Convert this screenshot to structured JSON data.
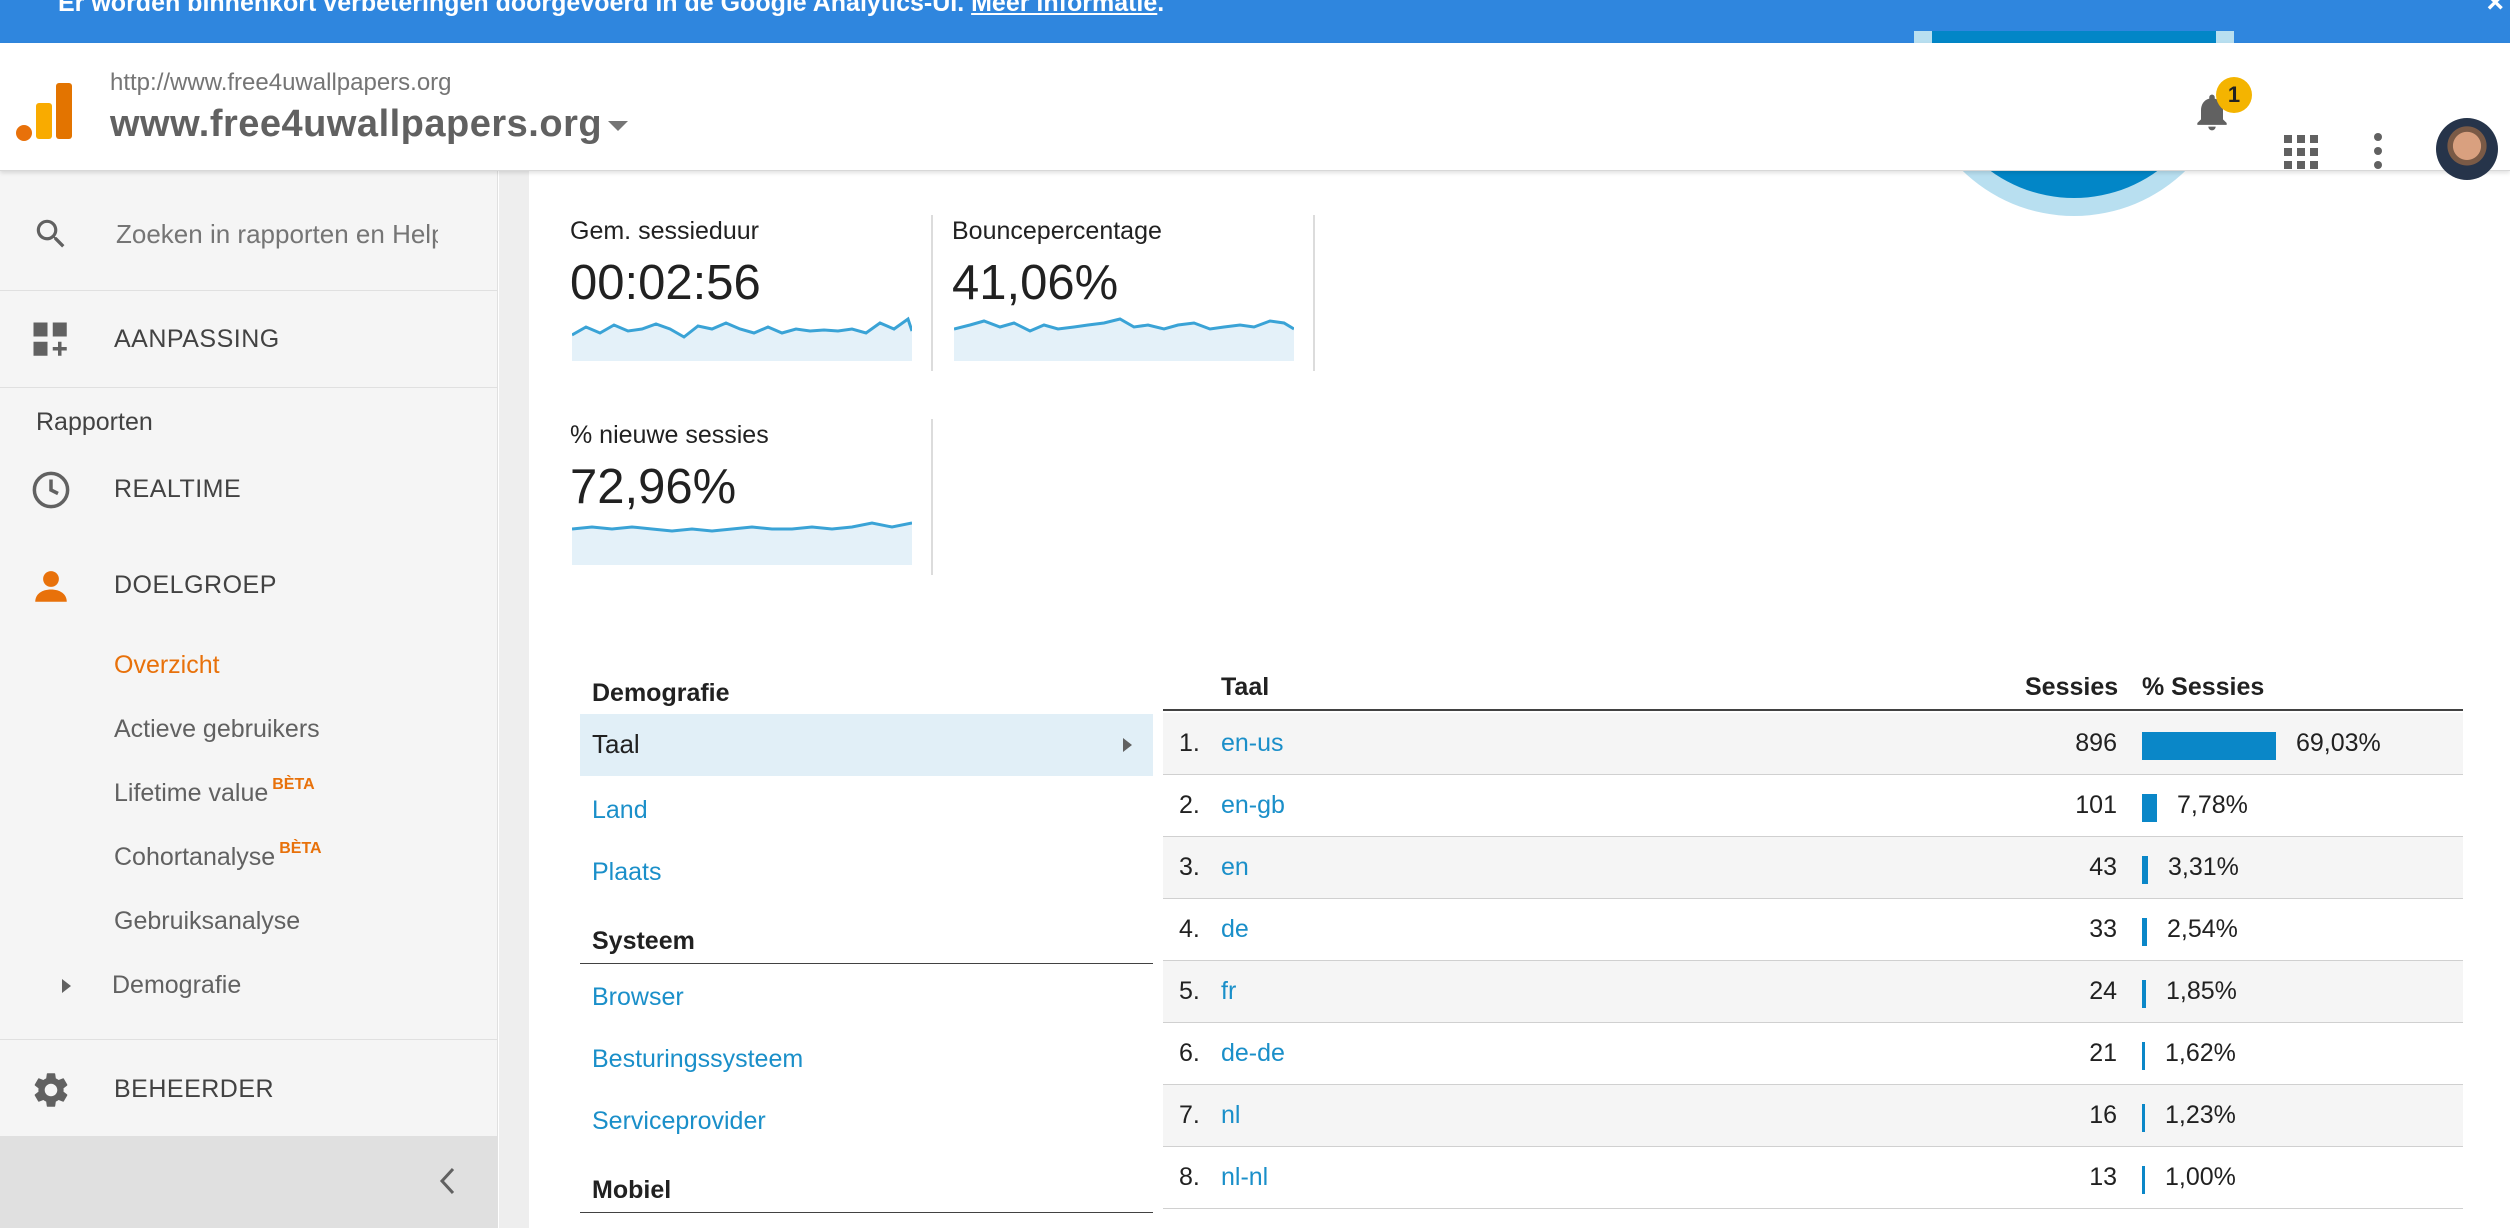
{
  "banner": {
    "text": "Er worden binnenkort verbeteringen doorgevoerd in de Google Analytics-UI.",
    "link": "Meer informatie",
    "after_link": ".",
    "close": "×"
  },
  "header": {
    "site_url": "http://www.free4uwallpapers.org",
    "site_name": "www.free4uwallpapers.org",
    "notification_count": "1"
  },
  "sidebar": {
    "search_placeholder": "Zoeken in rapporten en Help",
    "customization": "AANPASSING",
    "reports_section": "Rapporten",
    "realtime": "REALTIME",
    "audience": "DOELGROEP",
    "audience_items": [
      {
        "label": "Overzicht"
      },
      {
        "label": "Actieve gebruikers"
      },
      {
        "label": "Lifetime value",
        "badge": "BÈTA"
      },
      {
        "label": "Cohortanalyse",
        "badge": "BÈTA"
      },
      {
        "label": "Gebruiksanalyse"
      },
      {
        "label": "Demografie"
      }
    ],
    "admin": "BEHEERDER"
  },
  "metrics": [
    {
      "label": "Gem. sessieduur",
      "value": "00:02:56"
    },
    {
      "label": "Bouncepercentage",
      "value": "41,06%"
    },
    {
      "label": "% nieuwe sessies",
      "value": "72,96%"
    }
  ],
  "left_table": {
    "demografie_header": "Demografie",
    "demografie_items": [
      "Taal",
      "Land",
      "Plaats"
    ],
    "systeem_header": "Systeem",
    "systeem_items": [
      "Browser",
      "Besturingssysteem",
      "Serviceprovider"
    ],
    "mobiel_header": "Mobiel"
  },
  "right_table": {
    "col_language": "Taal",
    "col_sessions": "Sessies",
    "col_pct": "% Sessies",
    "rows": [
      {
        "idx": "1.",
        "lang": "en-us",
        "sessions": "896",
        "pct": "69,03%",
        "share": 0.6903
      },
      {
        "idx": "2.",
        "lang": "en-gb",
        "sessions": "101",
        "pct": "7,78%",
        "share": 0.0778
      },
      {
        "idx": "3.",
        "lang": "en",
        "sessions": "43",
        "pct": "3,31%",
        "share": 0.0331
      },
      {
        "idx": "4.",
        "lang": "de",
        "sessions": "33",
        "pct": "2,54%",
        "share": 0.0254
      },
      {
        "idx": "5.",
        "lang": "fr",
        "sessions": "24",
        "pct": "1,85%",
        "share": 0.0185
      },
      {
        "idx": "6.",
        "lang": "de-de",
        "sessions": "21",
        "pct": "1,62%",
        "share": 0.0162
      },
      {
        "idx": "7.",
        "lang": "nl",
        "sessions": "16",
        "pct": "1,23%",
        "share": 0.0123
      },
      {
        "idx": "8.",
        "lang": "nl-nl",
        "sessions": "13",
        "pct": "1,00%",
        "share": 0.01
      }
    ]
  },
  "colors": {
    "banner": "#2f86de",
    "accent_orange": "#e8710a",
    "link_blue": "#1a8fc9",
    "bar_blue": "#0a87c8",
    "sparkline": "#3aa3d6"
  }
}
